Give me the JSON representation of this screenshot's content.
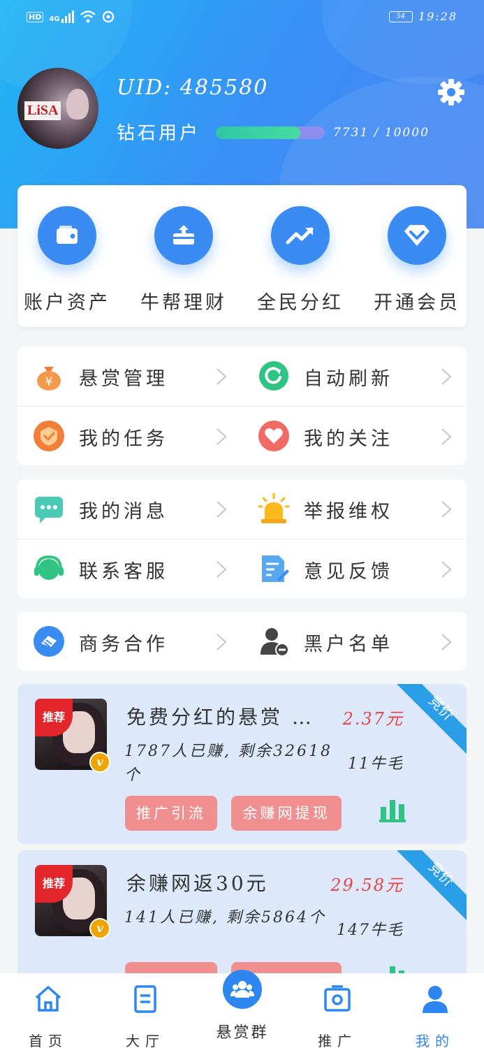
{
  "status_bar": {
    "left_text": "HD",
    "signal_text": "4G",
    "battery": "54",
    "time": "19:28"
  },
  "profile": {
    "avatar_text": "LiSA",
    "uid": "UID: 485580",
    "level": "钻石用户",
    "progress_text": "7731 / 10000",
    "progress_fraction": 0.7731
  },
  "quick_actions": [
    {
      "label": "账户资产",
      "icon": "wallet-icon"
    },
    {
      "label": "牛帮理财",
      "icon": "upload-card-icon"
    },
    {
      "label": "全民分红",
      "icon": "trend-up-icon"
    },
    {
      "label": "开通会员",
      "icon": "diamond-icon"
    }
  ],
  "menu": {
    "reward_manage": "悬赏管理",
    "auto_refresh": "自动刷新",
    "my_tasks": "我的任务",
    "my_follows": "我的关注",
    "my_messages": "我的消息",
    "report": "举报维权",
    "contact_service": "联系客服",
    "feedback": "意见反馈",
    "business": "商务合作",
    "blacklist": "黑户名单"
  },
  "rewards": [
    {
      "badge": "推荐",
      "title": "免费分红的悬赏 …",
      "price": "2.37元",
      "meta": "1787人已赚, 剩余32618个",
      "count": "11牛毛",
      "btn1": "推广引流",
      "btn2": "余赚网提现",
      "corner": "竞价"
    },
    {
      "badge": "推荐",
      "title": "余赚网返30元",
      "price": "29.58元",
      "meta": "141人已赚, 剩余5864个",
      "count": "147牛毛",
      "btn1": "",
      "btn2": "",
      "corner": "竞价"
    }
  ],
  "nav": {
    "home": "首页",
    "hall": "大厅",
    "group": "悬赏群",
    "promote": "推广",
    "mine": "我的"
  },
  "colors": {
    "primary": "#3a8bf2",
    "price": "#e9474b",
    "button": "#f08f8f",
    "active_nav": "#2e86f0"
  }
}
